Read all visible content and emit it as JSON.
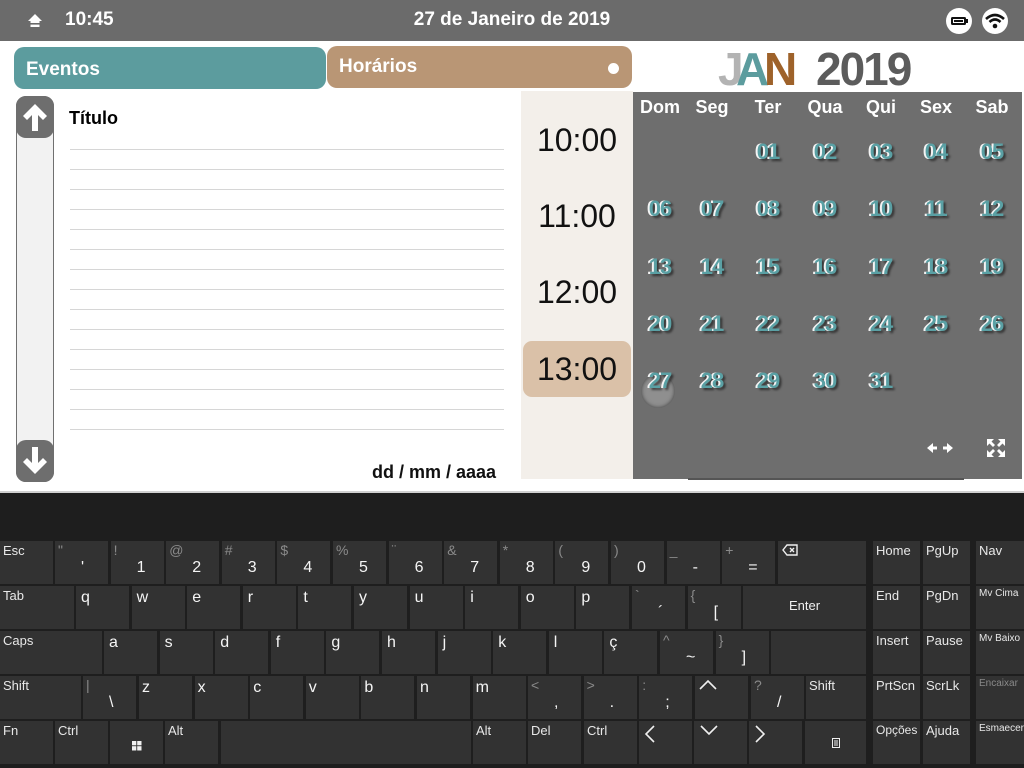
{
  "status_bar": {
    "time": "10:45",
    "date": "27 de Janeiro de 2019"
  },
  "tabs": {
    "events": "Eventos",
    "schedules": "Horários"
  },
  "month_header": {
    "letters": [
      "J",
      "A",
      "N"
    ],
    "year": "2019",
    "colors": [
      "#b3b3b3",
      "#5c9c9e",
      "#9e622a"
    ]
  },
  "event_form": {
    "title_label": "Título",
    "line_count": 15,
    "date_placeholder": "dd / mm / aaaa"
  },
  "times": {
    "slots": [
      "10:00",
      "11:00",
      "12:00",
      "13:00"
    ],
    "selected": "13:00"
  },
  "calendar": {
    "weekdays": [
      "Dom",
      "Seg",
      "Ter",
      "Qua",
      "Qui",
      "Sex",
      "Sab"
    ],
    "days": [
      "01",
      "02",
      "03",
      "04",
      "05",
      "06",
      "07",
      "08",
      "09",
      "10",
      "11",
      "12",
      "13",
      "14",
      "15",
      "16",
      "17",
      "18",
      "19",
      "20",
      "21",
      "22",
      "23",
      "24",
      "25",
      "26",
      "27",
      "28",
      "29",
      "30",
      "31"
    ],
    "first_weekday_index": 2,
    "today": "27",
    "day_color": "#5aa0a4"
  },
  "keyboard": {
    "esc": "Esc",
    "tab": "Tab",
    "caps": "Caps",
    "shift_left": "Shift",
    "shift_right": "Shift",
    "fn": "Fn",
    "ctrl_left": "Ctrl",
    "alt_left": "Alt",
    "alt_right": "Alt",
    "del": "Del",
    "ctrl_right": "Ctrl",
    "enter": "Enter",
    "number_row": [
      [
        "\"",
        "'"
      ],
      [
        "!",
        "1"
      ],
      [
        "@",
        "2"
      ],
      [
        "#",
        "3"
      ],
      [
        "$",
        "4"
      ],
      [
        "%",
        "5"
      ],
      [
        "¨",
        "6"
      ],
      [
        "&",
        "7"
      ],
      [
        "*",
        "8"
      ],
      [
        "(",
        "9"
      ],
      [
        ")",
        "0"
      ],
      [
        "_",
        "-"
      ],
      [
        "+",
        "="
      ]
    ],
    "row_q": [
      "q",
      "w",
      "e",
      "r",
      "t",
      "y",
      "u",
      "i",
      "o",
      "p"
    ],
    "row_q_extra": [
      [
        "`",
        "´"
      ],
      [
        "{",
        "["
      ]
    ],
    "row_a": [
      "a",
      "s",
      "d",
      "f",
      "g",
      "h",
      "j",
      "k",
      "l",
      "ç"
    ],
    "row_a_extra": [
      [
        "^",
        "~"
      ],
      [
        "}",
        "]"
      ]
    ],
    "row_z": [
      "z",
      "x",
      "c",
      "v",
      "b",
      "n",
      "m"
    ],
    "row_z_pipe": [
      "|",
      "\\"
    ],
    "row_z_extra": [
      [
        "<",
        ","
      ],
      [
        ">",
        "."
      ],
      [
        ":",
        ";"
      ]
    ],
    "row_z_slash": [
      "?",
      "/"
    ],
    "nav": {
      "home": "Home",
      "pgup": "PgUp",
      "nav": "Nav",
      "end": "End",
      "pgdn": "PgDn",
      "mv_up": "Mv Cima",
      "insert": "Insert",
      "pause": "Pause",
      "mv_down": "Mv Baixo",
      "prtscn": "PrtScn",
      "scrlk": "ScrLk",
      "dock": "Encaixar",
      "options": "Opções",
      "help": "Ajuda",
      "fade": "Esmaecer"
    }
  }
}
